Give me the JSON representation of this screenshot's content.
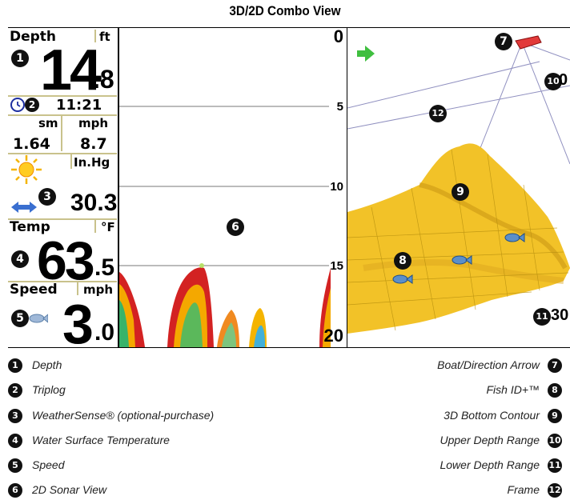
{
  "title": "3D/2D Combo View",
  "panel": {
    "depth_label": "Depth",
    "depth_unit": "ft",
    "depth_int": "14",
    "depth_dec": ".8",
    "clock": "11:21",
    "trip_dist_unit": "sm",
    "trip_speed_unit": "mph",
    "trip_dist": "1.64",
    "trip_speed": "8.7",
    "pressure_unit": "In.Hg",
    "pressure": "30.3",
    "temp_label": "Temp",
    "temp_unit": "°F",
    "temp_int": "63",
    "temp_dec": ".5",
    "speed_label": "Speed",
    "speed_unit": "mph",
    "speed_int": "3",
    "speed_dec": ".0"
  },
  "sonar": {
    "ticks": [
      "0",
      "5",
      "10",
      "15",
      "20"
    ]
  },
  "view3d": {
    "upper_range": "0",
    "lower_range": "30"
  },
  "callouts": [
    "1",
    "2",
    "3",
    "4",
    "5",
    "6",
    "7",
    "8",
    "9",
    "10",
    "11",
    "12"
  ],
  "legend_left": [
    {
      "num": "1",
      "text": "Depth"
    },
    {
      "num": "2",
      "text": "Triplog"
    },
    {
      "num": "3",
      "text": "WeatherSense® (optional-purchase)"
    },
    {
      "num": "4",
      "text": "Water Surface Temperature"
    },
    {
      "num": "5",
      "text": "Speed"
    },
    {
      "num": "6",
      "text": "2D Sonar View"
    }
  ],
  "legend_right": [
    {
      "num": "7",
      "text": "Boat/Direction Arrow"
    },
    {
      "num": "8",
      "text": "Fish ID+™"
    },
    {
      "num": "9",
      "text": "3D Bottom Contour"
    },
    {
      "num": "10",
      "text": "Upper Depth Range"
    },
    {
      "num": "11",
      "text": "Lower Depth Range"
    },
    {
      "num": "12",
      "text": "Frame"
    }
  ],
  "colors": {
    "contour": "#f2c228",
    "boat": "#e23a3a",
    "arrow": "#3fbf3f",
    "fish": "#5b8fc9",
    "sun": "#f4b400",
    "separator": "#c9c28c"
  }
}
